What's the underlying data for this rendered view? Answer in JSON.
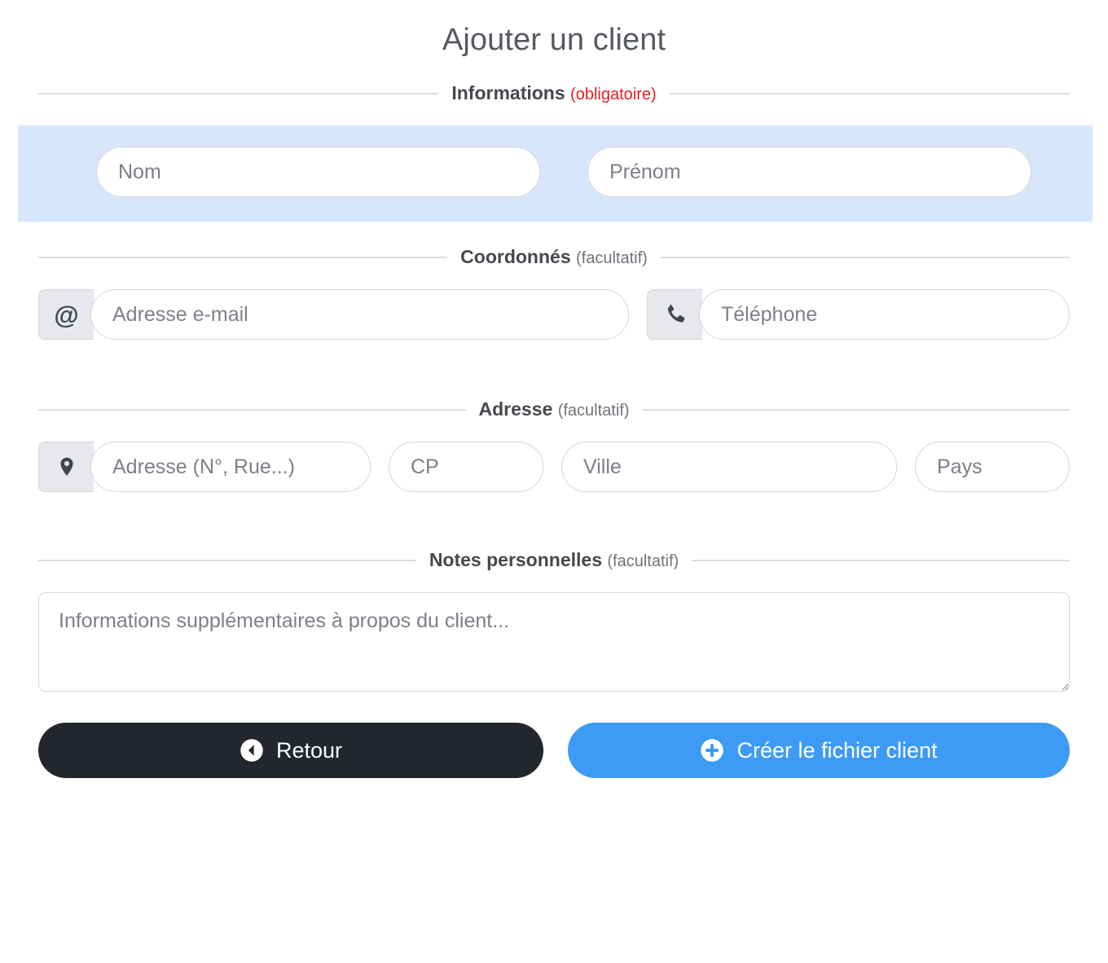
{
  "page": {
    "title": "Ajouter un client"
  },
  "sections": {
    "informations": {
      "heading": "Informations",
      "note": "(obligatoire)",
      "fields": {
        "nom_placeholder": "Nom",
        "prenom_placeholder": "Prénom"
      }
    },
    "coordonnes": {
      "heading": "Coordonnés",
      "note": "(facultatif)",
      "fields": {
        "email_placeholder": "Adresse e-mail",
        "email_icon": "at-icon",
        "phone_placeholder": "Téléphone",
        "phone_icon": "phone-icon"
      }
    },
    "adresse": {
      "heading": "Adresse",
      "note": "(facultatif)",
      "fields": {
        "street_placeholder": "Adresse (N°, Rue...)",
        "street_icon": "map-pin-icon",
        "cp_placeholder": "CP",
        "ville_placeholder": "Ville",
        "pays_placeholder": "Pays"
      }
    },
    "notes": {
      "heading": "Notes personnelles",
      "note": "(facultatif)",
      "fields": {
        "notes_placeholder": "Informations supplémentaires à propos du client..."
      }
    }
  },
  "actions": {
    "back_label": "Retour",
    "back_icon": "chevron-left-circle-icon",
    "create_label": "Créer le fichier client",
    "create_icon": "plus-circle-icon"
  },
  "colors": {
    "accent_blue": "#3d9bf5",
    "highlight_band": "#d6e7fb",
    "dark_button": "#23262c",
    "required_red": "#e81c22",
    "text_dark": "#45484d",
    "placeholder_gray": "#7c8087",
    "rule_gray": "#dcdcdc"
  }
}
